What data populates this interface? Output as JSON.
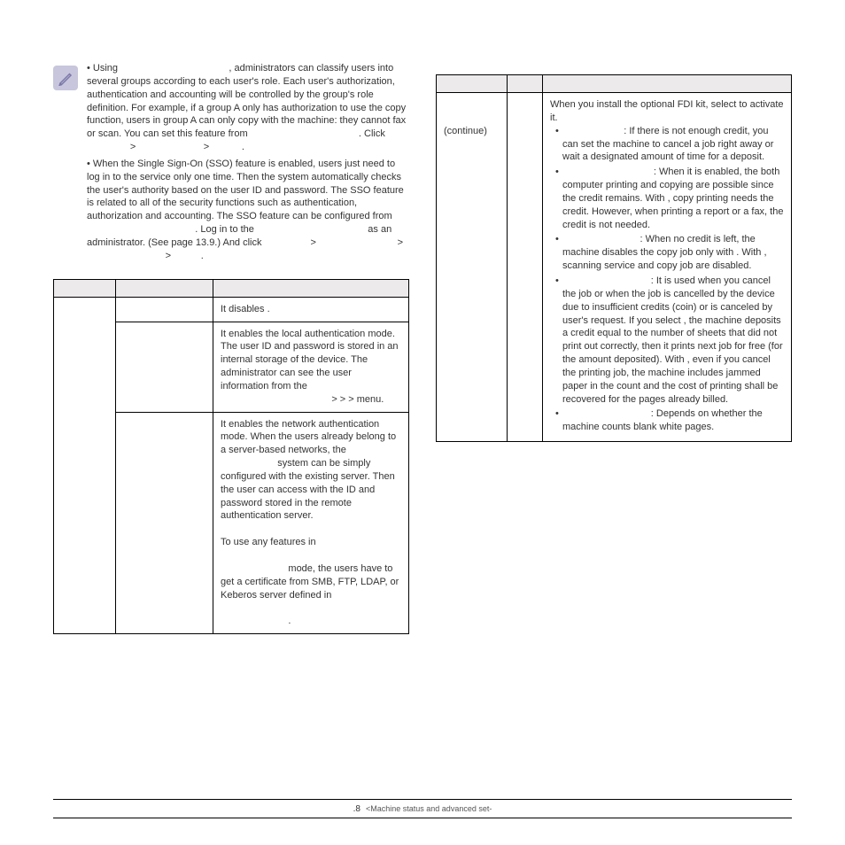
{
  "note": {
    "p1a": "• Using ",
    "p1b": ", administrators can classify users into several groups according to each user's role. Each user's authorization, authentication and accounting will be controlled by the group's role definition. For example, if a group A only has authorization to use the copy function, users in group A can only copy with the machine: they cannot fax or scan. You can set this feature from ",
    "p1c": ". Click ",
    "p1d": "> ",
    "p1e": "> ",
    "p1f": ".",
    "p2a": "• When the Single Sign-On (SSO) feature is enabled, users just need to log in to the service only one time. Then the system automatically checks the user's authority based on the user ID and password. The SSO feature is related to all of the security functions such as authentication, authorization and accounting. The SSO feature can be configured from ",
    "p2b": ". Log in to the ",
    "p2c": " as an administrator. (See page 13.9.) And click ",
    "p2d": " > ",
    "p2e": " > ",
    "p2f": " > ",
    "p2g": "."
  },
  "left_table": {
    "h1": "",
    "h2": "",
    "h3": "",
    "rows": [
      {
        "opt": "",
        "item": "",
        "desc": "It disables .",
        "desc_after": ""
      },
      {
        "opt": "",
        "item": "",
        "desc": "It enables the local authentication mode. The user ID and password is stored in an internal storage of the device. The administrator can see the user information from the ",
        "path": " >  >  >  menu."
      },
      {
        "opt": "",
        "item": "",
        "desc1": "It enables the network authentication mode. When the users already belong to a server-based networks, the ",
        "desc2": " system can be simply configured with the existing server. Then the user can access with the ID and password stored in the remote authentication server.",
        "desc3": "To use any features in ",
        "desc4": " mode, the users have to get a certificate from SMB, FTP, LDAP, or Keberos server defined in ",
        "desc5": "."
      }
    ]
  },
  "right_table": {
    "rows": [
      {
        "opt": "(continue)",
        "item": "",
        "intro": "When you install the optional FDI kit, select      to activate it.",
        "bullets": [
          {
            "pre": "",
            "txt": ": If there is not enough credit, you can set the machine to cancel a job right away or wait a designated amount of time for a deposit."
          },
          {
            "pre": "",
            "txt": ": When it is enabled, the both computer printing and copying are possible since the credit remains. With      , copy printing needs the credit. However, when printing a report or a fax, the credit is not needed."
          },
          {
            "pre": "",
            "txt": ": When no credit is left, the machine disables the copy job only with               . With       , scanning service and copy job are disabled."
          },
          {
            "pre": "",
            "txt": ": It is used when you cancel the job or when the job is cancelled by the device due to insufficient credits (coin) or is canceled by user's request. If you select           , the machine deposits a credit equal to the number of sheets that did not print out correctly, then it prints next job for free (for the amount deposited). With           , even if you cancel the printing job, the machine includes jammed paper in the count and the cost of printing shall be recovered for the pages already billed."
          },
          {
            "pre": "",
            "txt": ": Depends on whether the machine counts blank white pages."
          }
        ]
      }
    ]
  },
  "footer": {
    "pageno": ".8",
    "title": "<Machine status and advanced set-"
  }
}
